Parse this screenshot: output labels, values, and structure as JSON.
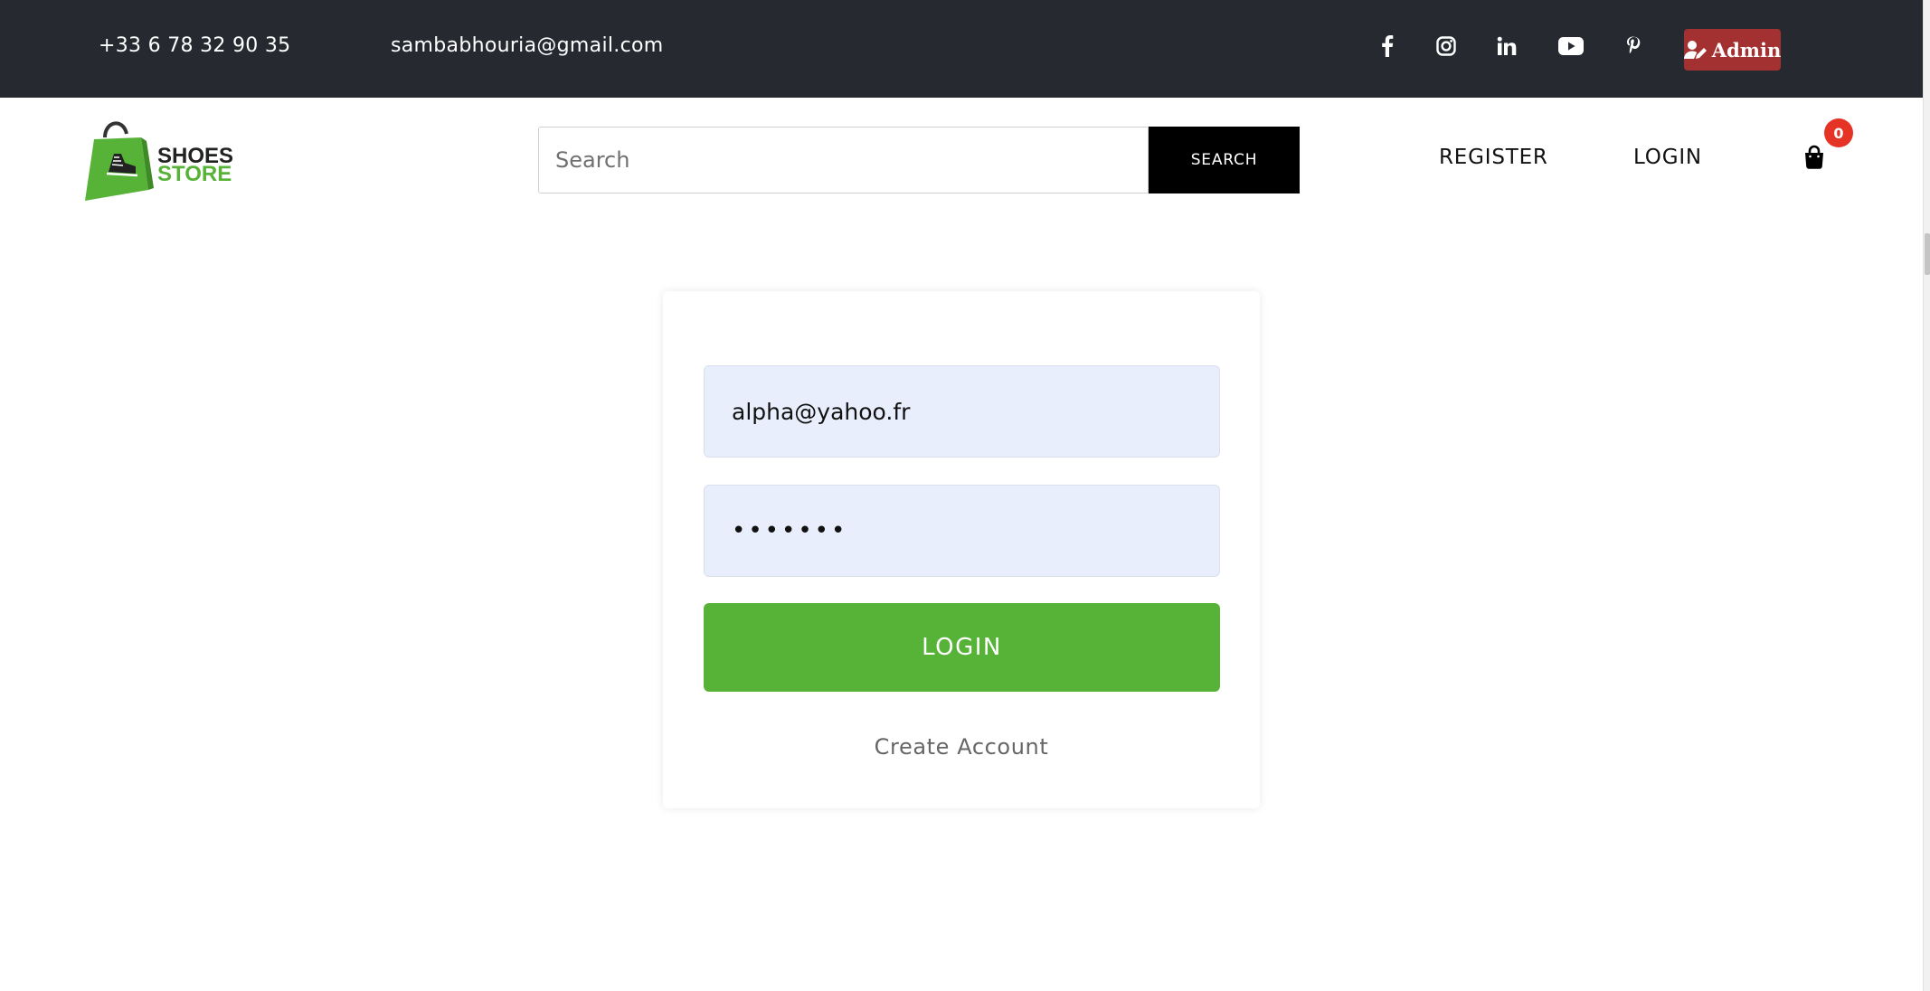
{
  "topbar": {
    "phone": "+33 6 78 32 90 35",
    "email": "sambabhouria@gmail.com",
    "social_icons": [
      "facebook-icon",
      "instagram-icon",
      "linkedin-icon",
      "youtube-icon",
      "pinterest-icon"
    ],
    "admin_label": "Admin",
    "admin_color": "#a43131",
    "background_color": "#262a30"
  },
  "header": {
    "logo_line1": "SHOES",
    "logo_line2": "STORE",
    "brand_color": "#57b337",
    "search": {
      "placeholder": "Search",
      "button_label": "SEARCH"
    },
    "nav": {
      "register": "REGISTER",
      "login": "LOGIN"
    },
    "cart_count": "0"
  },
  "login_form": {
    "email_value": "alpha@yahoo.fr",
    "password_value": "•••••••",
    "submit_label": "LOGIN",
    "create_account_label": "Create Account",
    "field_background": "#e8eefb"
  }
}
